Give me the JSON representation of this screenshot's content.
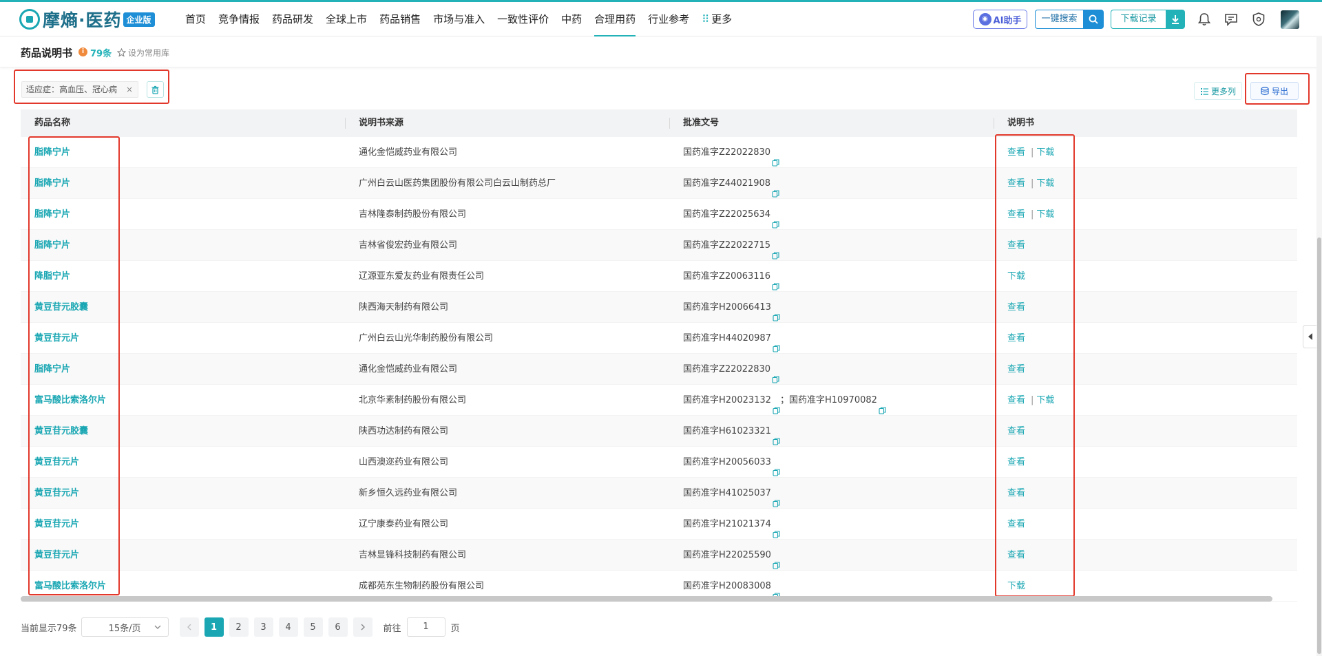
{
  "header": {
    "logo_text": "摩熵·医药",
    "logo_badge": "企业版",
    "nav": [
      "首页",
      "竞争情报",
      "药品研发",
      "全球上市",
      "药品销售",
      "市场与准入",
      "一致性评价",
      "中药",
      "合理用药",
      "行业参考",
      "更多"
    ],
    "active_nav": "合理用药",
    "ai_label": "AI助手",
    "search_label": "一键搜索",
    "download_label": "下载记录"
  },
  "subheader": {
    "title": "药品说明书",
    "count": "79条",
    "fav_label": "设为常用库"
  },
  "filter": {
    "chip": "适应症：高血压、冠心病",
    "more_cols": "更多列",
    "export": "导出"
  },
  "table": {
    "columns": [
      "药品名称",
      "说明书来源",
      "批准文号",
      "说明书"
    ],
    "rows": [
      {
        "name": "脂降宁片",
        "source": "通化金恺威药业有限公司",
        "approvals": [
          "国药准字Z22022830"
        ],
        "actions": [
          "查看",
          "下载"
        ]
      },
      {
        "name": "脂降宁片",
        "source": "广州白云山医药集团股份有限公司白云山制药总厂",
        "approvals": [
          "国药准字Z44021908"
        ],
        "actions": [
          "查看",
          "下载"
        ]
      },
      {
        "name": "脂降宁片",
        "source": "吉林隆泰制药股份有限公司",
        "approvals": [
          "国药准字Z22025634"
        ],
        "actions": [
          "查看",
          "下载"
        ]
      },
      {
        "name": "脂降宁片",
        "source": "吉林省俊宏药业有限公司",
        "approvals": [
          "国药准字Z22022715"
        ],
        "actions": [
          "查看"
        ]
      },
      {
        "name": "降脂宁片",
        "source": "辽源亚东爱友药业有限责任公司",
        "approvals": [
          "国药准字Z20063116"
        ],
        "actions": [
          "下载"
        ]
      },
      {
        "name": "黄豆苷元胶囊",
        "source": "陕西海天制药有限公司",
        "approvals": [
          "国药准字H20066413"
        ],
        "actions": [
          "查看"
        ]
      },
      {
        "name": "黄豆苷元片",
        "source": "广州白云山光华制药股份有限公司",
        "approvals": [
          "国药准字H44020987"
        ],
        "actions": [
          "查看"
        ]
      },
      {
        "name": "脂降宁片",
        "source": "通化金恺威药业有限公司",
        "approvals": [
          "国药准字Z22022830"
        ],
        "actions": [
          "查看"
        ]
      },
      {
        "name": "富马酸比索洛尔片",
        "source": "北京华素制药股份有限公司",
        "approvals": [
          "国药准字H20023132",
          "国药准字H10970082"
        ],
        "actions": [
          "查看",
          "下载"
        ]
      },
      {
        "name": "黄豆苷元胶囊",
        "source": "陕西功达制药有限公司",
        "approvals": [
          "国药准字H61023321"
        ],
        "actions": [
          "查看"
        ]
      },
      {
        "name": "黄豆苷元片",
        "source": "山西澳迩药业有限公司",
        "approvals": [
          "国药准字H20056033"
        ],
        "actions": [
          "查看"
        ]
      },
      {
        "name": "黄豆苷元片",
        "source": "新乡恒久远药业有限公司",
        "approvals": [
          "国药准字H41025037"
        ],
        "actions": [
          "查看"
        ]
      },
      {
        "name": "黄豆苷元片",
        "source": "辽宁康泰药业有限公司",
        "approvals": [
          "国药准字H21021374"
        ],
        "actions": [
          "查看"
        ]
      },
      {
        "name": "黄豆苷元片",
        "source": "吉林显锋科技制药有限公司",
        "approvals": [
          "国药准字H22025590"
        ],
        "actions": [
          "查看"
        ]
      },
      {
        "name": "富马酸比索洛尔片",
        "source": "成都苑东生物制药股份有限公司",
        "approvals": [
          "国药准字H20083008"
        ],
        "actions": [
          "下载"
        ]
      }
    ]
  },
  "pagination": {
    "total": "当前显示79条",
    "page_size": "15条/页",
    "pages": [
      "1",
      "2",
      "3",
      "4",
      "5",
      "6"
    ],
    "current": "1",
    "goto_label": "前往",
    "goto_value": "1",
    "page_suffix": "页"
  },
  "colors": {
    "accent": "#1aa7b3",
    "highlight_border": "#e2382b",
    "brand_blue": "#1e8fd6"
  },
  "icons": [
    "logo-icon",
    "ai-icon",
    "search-icon",
    "download-icon",
    "bell-icon",
    "feedback-icon",
    "shield-icon",
    "info-icon",
    "star-icon",
    "trash-icon",
    "list-icon",
    "export-icon",
    "copy-icon",
    "chevron-down-icon",
    "chevron-left-icon",
    "chevron-right-icon",
    "caret-left-icon"
  ]
}
